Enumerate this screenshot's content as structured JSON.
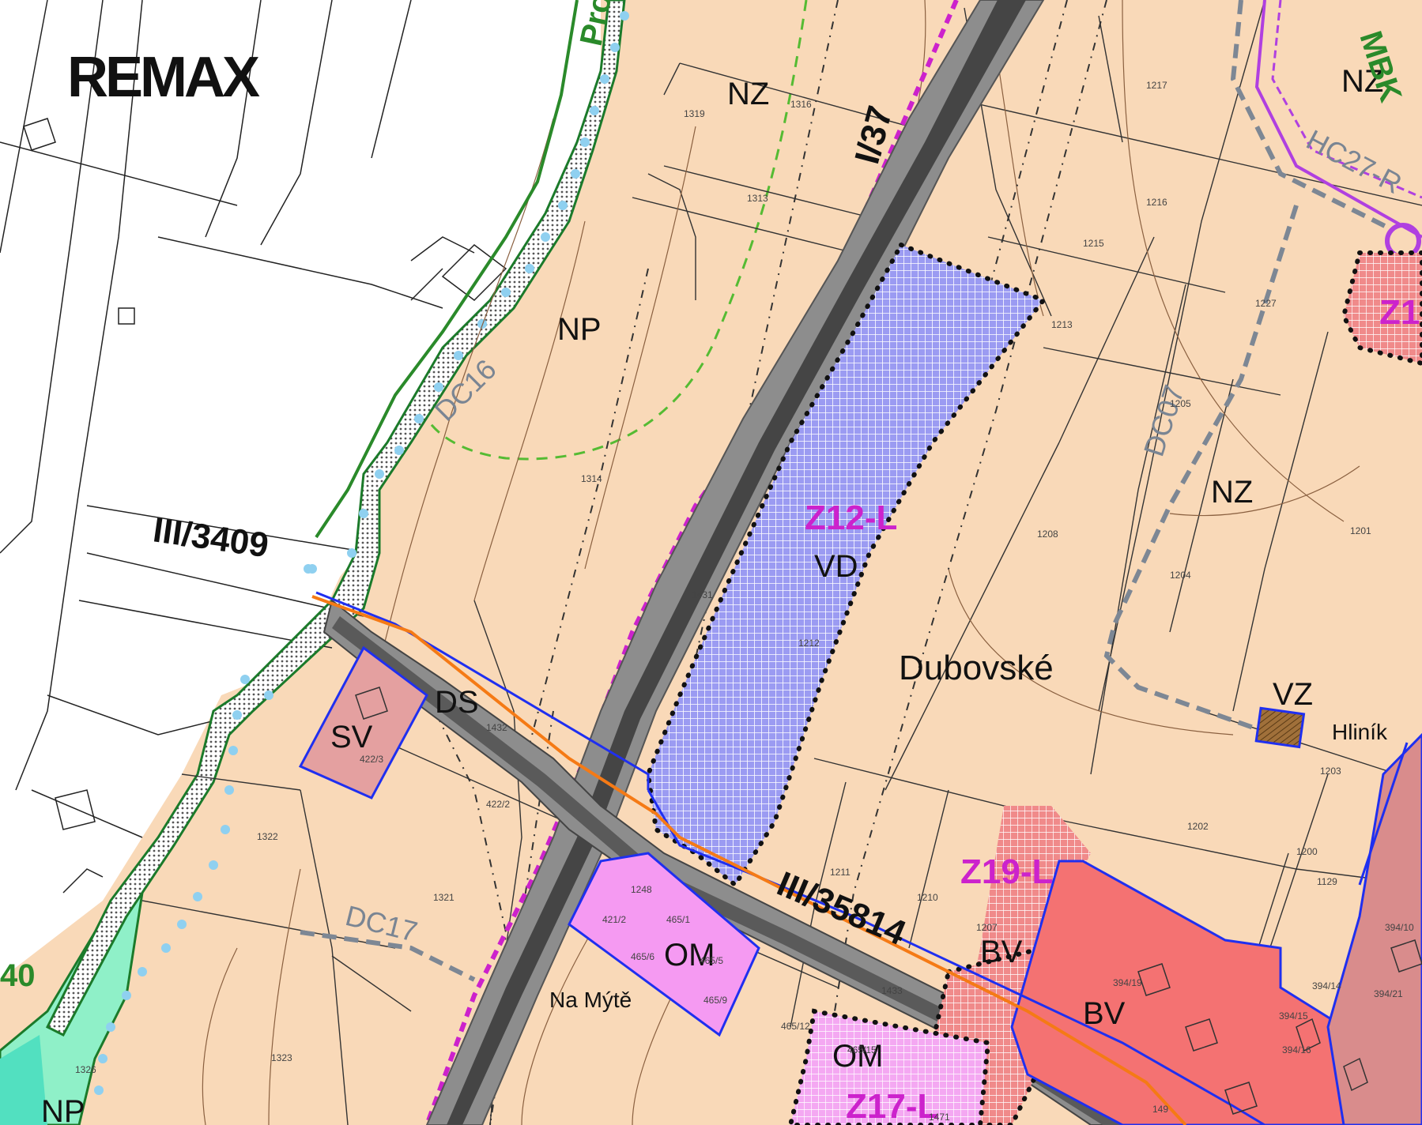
{
  "logo": {
    "text": "REMAX"
  },
  "zones": {
    "nz_top": "NZ",
    "nz_topright": "NZ",
    "nz_right": "NZ",
    "np_mid": "NP",
    "np_bottom": "NP",
    "vd": "VD",
    "vz": "VZ",
    "sv": "SV",
    "ds": "DS",
    "om_left": "OM",
    "om_bottom": "OM",
    "bv_1": "BV",
    "bv_2": "BV"
  },
  "projects": {
    "z12": "Z12-L",
    "z19": "Z19-L",
    "z17": "Z17-L",
    "z1_partial": "Z1"
  },
  "roads": {
    "i37": "I/37",
    "iii3409": "III/3409",
    "iii35814": "III/35814"
  },
  "corridors": {
    "dc07": "DC07",
    "dc16": "DC16",
    "dc17": "DC17",
    "hc27": "HC27-R"
  },
  "places": {
    "dubovske": "Dubovské",
    "hlinik": "Hliník",
    "na_myte": "Na Mýtě"
  },
  "edge_labels": {
    "pro_partial": "Pro",
    "mbk_partial": "MBK",
    "num_40": "40"
  },
  "parcels": [
    "1316",
    "1217",
    "1319",
    "1313",
    "1216",
    "1215",
    "1213",
    "1227",
    "1205",
    "1314",
    "1208",
    "1201",
    "1204",
    "1431",
    "1212",
    "1322",
    "422/2",
    "422/3",
    "1432",
    "1211",
    "1210",
    "1202",
    "1200",
    "1321",
    "1207",
    "1248",
    "421/2",
    "465/1",
    "465/6",
    "465/5",
    "465/9",
    "465/12",
    "465/15",
    "1433",
    "394/19",
    "1203",
    "394/14",
    "394/15",
    "394/16",
    "394/21",
    "1323",
    "1326",
    "1471",
    "149",
    "1129",
    "394/10"
  ],
  "colors": {
    "agri": "#f9d9b8",
    "vd_fill": "#9b9bf2",
    "om_fill": "#f59af2",
    "bv_fill": "#f47272",
    "sv_fill": "#e4a0a0",
    "road_gray": "#7c7c7c",
    "road_dark": "#444444",
    "magenta": "#cc22cc",
    "blue": "#1f2ff0",
    "orange": "#f57a15",
    "green": "#2a8a2a",
    "teal": "#52e0c0"
  }
}
